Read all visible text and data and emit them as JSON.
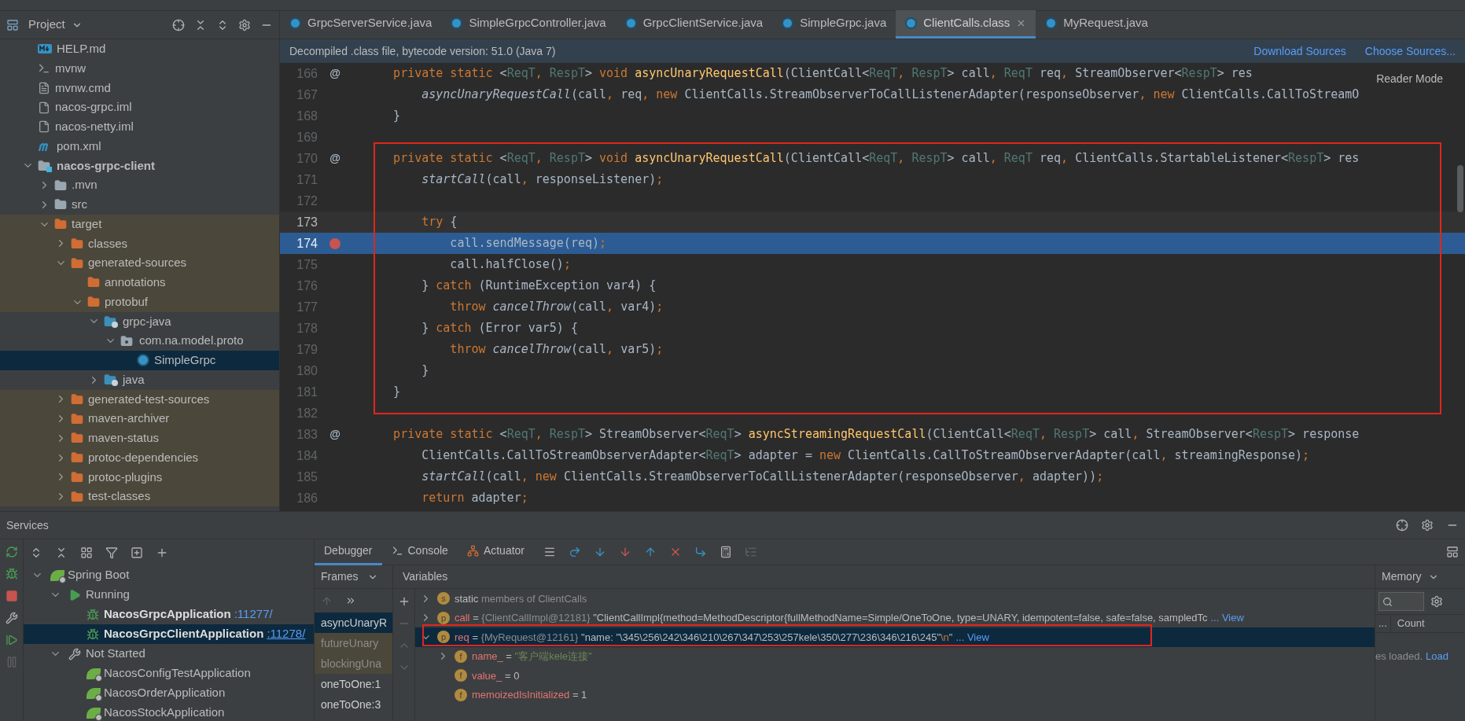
{
  "project_panel": {
    "title": "Project"
  },
  "project_tree": [
    {
      "label": "HELP.md",
      "kind": "md",
      "selected": false,
      "excluded": false
    },
    {
      "label": "mvnw",
      "kind": "script",
      "selected": false,
      "excluded": false
    },
    {
      "label": "mvnw.cmd",
      "kind": "text",
      "selected": false,
      "excluded": false
    },
    {
      "label": "nacos-grpc.iml",
      "kind": "iml",
      "selected": false,
      "excluded": false
    },
    {
      "label": "nacos-netty.iml",
      "kind": "iml",
      "selected": false,
      "excluded": false
    },
    {
      "label": "pom.xml",
      "kind": "maven",
      "selected": false,
      "excluded": false
    },
    {
      "label": "nacos-grpc-client",
      "kind": "module",
      "selected": false,
      "excluded": false,
      "expanded": true,
      "children": [
        {
          "label": ".mvn",
          "kind": "folder",
          "selected": false,
          "excluded": false,
          "expanded": false
        },
        {
          "label": "src",
          "kind": "folder",
          "selected": false,
          "excluded": false,
          "expanded": false
        },
        {
          "label": "target",
          "kind": "folder",
          "selected": false,
          "excluded": true,
          "expanded": true,
          "children": [
            {
              "label": "classes",
              "kind": "folder",
              "selected": false,
              "excluded": true,
              "expanded": false
            },
            {
              "label": "generated-sources",
              "kind": "folder",
              "selected": false,
              "excluded": true,
              "expanded": true,
              "children": [
                {
                  "label": "annotations",
                  "kind": "folder",
                  "selected": false,
                  "excluded": true
                },
                {
                  "label": "protobuf",
                  "kind": "folder",
                  "selected": false,
                  "excluded": true,
                  "expanded": true,
                  "children": [
                    {
                      "label": "grpc-java",
                      "kind": "source",
                      "selected": false,
                      "excluded": false,
                      "expanded": true,
                      "children": [
                        {
                          "label": "com.na.model.proto",
                          "kind": "package",
                          "selected": false,
                          "excluded": false,
                          "expanded": true,
                          "children": [
                            {
                              "label": "SimpleGrpc",
                              "kind": "class",
                              "selected": true
                            }
                          ]
                        }
                      ]
                    },
                    {
                      "label": "java",
                      "kind": "source",
                      "selected": false,
                      "excluded": false,
                      "expanded": false
                    }
                  ]
                }
              ]
            },
            {
              "label": "generated-test-sources",
              "kind": "folder",
              "selected": false,
              "excluded": true,
              "expanded": false
            },
            {
              "label": "maven-archiver",
              "kind": "folder",
              "selected": false,
              "excluded": true,
              "expanded": false
            },
            {
              "label": "maven-status",
              "kind": "folder",
              "selected": false,
              "excluded": true,
              "expanded": false
            },
            {
              "label": "protoc-dependencies",
              "kind": "folder",
              "selected": false,
              "excluded": true,
              "expanded": false
            },
            {
              "label": "protoc-plugins",
              "kind": "folder",
              "selected": false,
              "excluded": true,
              "expanded": false
            },
            {
              "label": "test-classes",
              "kind": "folder",
              "selected": false,
              "excluded": true,
              "expanded": false
            }
          ]
        }
      ]
    }
  ],
  "tabs": [
    {
      "label": "GrpcServerService.java",
      "selected": false
    },
    {
      "label": "SimpleGrpcController.java",
      "selected": false
    },
    {
      "label": "GrpcClientService.java",
      "selected": false
    },
    {
      "label": "SimpleGrpc.java",
      "selected": false
    },
    {
      "label": "ClientCalls.class",
      "selected": true
    },
    {
      "label": "MyRequest.java",
      "selected": false
    }
  ],
  "notice": {
    "text": "Decompiled .class file, bytecode version: 51.0 (Java 7)",
    "actions": [
      "Download Sources",
      "Choose Sources..."
    ]
  },
  "reader_mode": "Reader Mode",
  "code_lines": [
    {
      "number": "166",
      "annotation": "@",
      "selected": false,
      "caret": false,
      "tokens": [
        {
          "kind": "kw",
          "text": "    private static "
        },
        {
          "kind": "p",
          "text": "<"
        },
        {
          "kind": "gen",
          "text": "ReqT"
        },
        {
          "kind": "punc",
          "text": ", "
        },
        {
          "kind": "gen",
          "text": "RespT"
        },
        {
          "kind": "p",
          "text": "> "
        },
        {
          "kind": "kw",
          "text": "void "
        },
        {
          "kind": "decl",
          "text": "asyncUnaryRequestCall"
        },
        {
          "kind": "p",
          "text": "(ClientCall<"
        },
        {
          "kind": "gen",
          "text": "ReqT"
        },
        {
          "kind": "punc",
          "text": ", "
        },
        {
          "kind": "gen",
          "text": "RespT"
        },
        {
          "kind": "p",
          "text": "> call"
        },
        {
          "kind": "punc",
          "text": ", "
        },
        {
          "kind": "gen",
          "text": "ReqT "
        },
        {
          "kind": "p",
          "text": "req"
        },
        {
          "kind": "punc",
          "text": ", "
        },
        {
          "kind": "p",
          "text": "StreamObserver<"
        },
        {
          "kind": "gen",
          "text": "RespT"
        },
        {
          "kind": "p",
          "text": "> res"
        }
      ]
    },
    {
      "number": "167",
      "selected": false,
      "caret": false,
      "tokens": [
        {
          "kind": "it",
          "text": "        asyncUnaryRequestCall"
        },
        {
          "kind": "p",
          "text": "(call"
        },
        {
          "kind": "punc",
          "text": ", "
        },
        {
          "kind": "p",
          "text": "req"
        },
        {
          "kind": "punc",
          "text": ", "
        },
        {
          "kind": "kw",
          "text": "new "
        },
        {
          "kind": "p",
          "text": "ClientCalls.StreamObserverToCallListenerAdapter(responseObserver"
        },
        {
          "kind": "punc",
          "text": ", "
        },
        {
          "kind": "kw",
          "text": "new "
        },
        {
          "kind": "p",
          "text": "ClientCalls.CallToStreamO"
        }
      ]
    },
    {
      "number": "168",
      "selected": false,
      "caret": false,
      "tokens": [
        {
          "kind": "p",
          "text": "    }"
        }
      ]
    },
    {
      "number": "169",
      "selected": false,
      "caret": false
    },
    {
      "number": "170",
      "annotation": "@",
      "selected": false,
      "caret": false,
      "tokens": [
        {
          "kind": "kw",
          "text": "    private static "
        },
        {
          "kind": "p",
          "text": "<"
        },
        {
          "kind": "gen",
          "text": "ReqT"
        },
        {
          "kind": "punc",
          "text": ", "
        },
        {
          "kind": "gen",
          "text": "RespT"
        },
        {
          "kind": "p",
          "text": "> "
        },
        {
          "kind": "kw",
          "text": "void "
        },
        {
          "kind": "decl",
          "text": "asyncUnaryRequestCall"
        },
        {
          "kind": "p",
          "text": "(ClientCall<"
        },
        {
          "kind": "gen",
          "text": "ReqT"
        },
        {
          "kind": "punc",
          "text": ", "
        },
        {
          "kind": "gen",
          "text": "RespT"
        },
        {
          "kind": "p",
          "text": "> call"
        },
        {
          "kind": "punc",
          "text": ", "
        },
        {
          "kind": "gen",
          "text": "ReqT "
        },
        {
          "kind": "p",
          "text": "req"
        },
        {
          "kind": "punc",
          "text": ", "
        },
        {
          "kind": "p",
          "text": "ClientCalls.StartableListener<"
        },
        {
          "kind": "gen",
          "text": "RespT"
        },
        {
          "kind": "p",
          "text": "> res"
        }
      ]
    },
    {
      "number": "171",
      "selected": false,
      "caret": false,
      "tokens": [
        {
          "kind": "it",
          "text": "        startCall"
        },
        {
          "kind": "p",
          "text": "(call"
        },
        {
          "kind": "punc",
          "text": ", "
        },
        {
          "kind": "p",
          "text": "responseListener)"
        },
        {
          "kind": "punc",
          "text": ";"
        }
      ]
    },
    {
      "number": "172",
      "selected": false,
      "caret": false
    },
    {
      "number": "173",
      "selected": false,
      "caret": true,
      "tokens": [
        {
          "kind": "kw",
          "text": "        try "
        },
        {
          "kind": "p",
          "text": "{"
        }
      ]
    },
    {
      "number": "174",
      "breakpoint": true,
      "selected": true,
      "caret": false,
      "tokens": [
        {
          "kind": "p",
          "text": "            call.sendMessage(req)"
        },
        {
          "kind": "punc",
          "text": ";"
        }
      ]
    },
    {
      "number": "175",
      "selected": false,
      "caret": false,
      "tokens": [
        {
          "kind": "p",
          "text": "            call.halfClose()"
        },
        {
          "kind": "punc",
          "text": ";"
        }
      ]
    },
    {
      "number": "176",
      "selected": false,
      "caret": false,
      "tokens": [
        {
          "kind": "p",
          "text": "        } "
        },
        {
          "kind": "kw",
          "text": "catch "
        },
        {
          "kind": "p",
          "text": "(RuntimeException var4) {"
        }
      ]
    },
    {
      "number": "177",
      "selected": false,
      "caret": false,
      "tokens": [
        {
          "kind": "kw",
          "text": "            throw "
        },
        {
          "kind": "it",
          "text": "cancelThrow"
        },
        {
          "kind": "p",
          "text": "(call"
        },
        {
          "kind": "punc",
          "text": ", "
        },
        {
          "kind": "p",
          "text": "var4)"
        },
        {
          "kind": "punc",
          "text": ";"
        }
      ]
    },
    {
      "number": "178",
      "selected": false,
      "caret": false,
      "tokens": [
        {
          "kind": "p",
          "text": "        } "
        },
        {
          "kind": "kw",
          "text": "catch "
        },
        {
          "kind": "p",
          "text": "(Error var5) {"
        }
      ]
    },
    {
      "number": "179",
      "selected": false,
      "caret": false,
      "tokens": [
        {
          "kind": "kw",
          "text": "            throw "
        },
        {
          "kind": "it",
          "text": "cancelThrow"
        },
        {
          "kind": "p",
          "text": "(call"
        },
        {
          "kind": "punc",
          "text": ", "
        },
        {
          "kind": "p",
          "text": "var5)"
        },
        {
          "kind": "punc",
          "text": ";"
        }
      ]
    },
    {
      "number": "180",
      "selected": false,
      "caret": false,
      "tokens": [
        {
          "kind": "p",
          "text": "        }"
        }
      ]
    },
    {
      "number": "181",
      "selected": false,
      "caret": false,
      "tokens": [
        {
          "kind": "p",
          "text": "    }"
        }
      ]
    },
    {
      "number": "182",
      "selected": false,
      "caret": false
    },
    {
      "number": "183",
      "annotation": "@",
      "selected": false,
      "caret": false,
      "tokens": [
        {
          "kind": "kw",
          "text": "    private static "
        },
        {
          "kind": "p",
          "text": "<"
        },
        {
          "kind": "gen",
          "text": "ReqT"
        },
        {
          "kind": "punc",
          "text": ", "
        },
        {
          "kind": "gen",
          "text": "RespT"
        },
        {
          "kind": "p",
          "text": "> StreamObserver<"
        },
        {
          "kind": "gen",
          "text": "ReqT"
        },
        {
          "kind": "p",
          "text": "> "
        },
        {
          "kind": "decl",
          "text": "asyncStreamingRequestCall"
        },
        {
          "kind": "p",
          "text": "(ClientCall<"
        },
        {
          "kind": "gen",
          "text": "ReqT"
        },
        {
          "kind": "punc",
          "text": ", "
        },
        {
          "kind": "gen",
          "text": "RespT"
        },
        {
          "kind": "p",
          "text": "> call"
        },
        {
          "kind": "punc",
          "text": ", "
        },
        {
          "kind": "p",
          "text": "StreamObserver<"
        },
        {
          "kind": "gen",
          "text": "RespT"
        },
        {
          "kind": "p",
          "text": "> response"
        }
      ]
    },
    {
      "number": "184",
      "selected": false,
      "caret": false,
      "tokens": [
        {
          "kind": "p",
          "text": "        ClientCalls.CallToStreamObserverAdapter<"
        },
        {
          "kind": "gen",
          "text": "ReqT"
        },
        {
          "kind": "p",
          "text": "> adapter = "
        },
        {
          "kind": "kw",
          "text": "new "
        },
        {
          "kind": "p",
          "text": "ClientCalls.CallToStreamObserverAdapter(call"
        },
        {
          "kind": "punc",
          "text": ", "
        },
        {
          "kind": "p",
          "text": "streamingResponse)"
        },
        {
          "kind": "punc",
          "text": ";"
        }
      ]
    },
    {
      "number": "185",
      "selected": false,
      "caret": false,
      "tokens": [
        {
          "kind": "it",
          "text": "        startCall"
        },
        {
          "kind": "p",
          "text": "(call"
        },
        {
          "kind": "punc",
          "text": ", "
        },
        {
          "kind": "kw",
          "text": "new "
        },
        {
          "kind": "p",
          "text": "ClientCalls.StreamObserverToCallListenerAdapter(responseObserver"
        },
        {
          "kind": "punc",
          "text": ", "
        },
        {
          "kind": "p",
          "text": "adapter))"
        },
        {
          "kind": "punc",
          "text": ";"
        }
      ]
    },
    {
      "number": "186",
      "selected": false,
      "caret": false,
      "tokens": [
        {
          "kind": "kw",
          "text": "        return "
        },
        {
          "kind": "p",
          "text": "adapter"
        },
        {
          "kind": "punc",
          "text": ";"
        }
      ]
    }
  ],
  "services": {
    "title": "Services",
    "tree": [
      {
        "label": "Spring Boot",
        "kind": "group",
        "expanded": true,
        "selected": false,
        "children": [
          {
            "label": "Running",
            "kind": "running",
            "expanded": true,
            "selected": false,
            "children": [
              {
                "label": "NacosGrpcApplication",
                "port": ":11277/",
                "kind": "app-debug",
                "selected": false
              },
              {
                "label": "NacosGrpcClientApplication",
                "port": ":11278/",
                "kind": "app-debug",
                "selected": true
              }
            ]
          },
          {
            "label": "Not Started",
            "kind": "stopped",
            "expanded": true,
            "selected": false,
            "children": [
              {
                "label": "NacosConfigTestApplication",
                "kind": "app",
                "selected": false
              },
              {
                "label": "NacosOrderApplication",
                "kind": "app",
                "selected": false
              },
              {
                "label": "NacosStockApplication",
                "kind": "app",
                "selected": false
              }
            ]
          }
        ]
      }
    ]
  },
  "debugger": {
    "tabs": [
      {
        "label": "Debugger",
        "kind": "debugger",
        "selected": true
      },
      {
        "label": "Console",
        "kind": "console",
        "selected": false
      },
      {
        "label": "Actuator",
        "kind": "actuator",
        "selected": false
      }
    ],
    "frames_title": "Frames",
    "frames": [
      {
        "label": "asyncUnaryR",
        "selected": true,
        "library": false
      },
      {
        "label": "futureUnary",
        "selected": false,
        "library": true
      },
      {
        "label": "blockingUna",
        "selected": false,
        "library": true
      },
      {
        "label": "oneToOne:1",
        "selected": false,
        "library": false
      },
      {
        "label": "oneToOne:3",
        "selected": false,
        "library": false
      }
    ],
    "variables_title": "Variables",
    "variables": [
      {
        "badge": "s",
        "name": "static",
        "detail": "members of ClientCalls",
        "expanded": false,
        "selected": false
      },
      {
        "badge": "p",
        "name": "call",
        "expanded": false,
        "selected": false,
        "parts": [
          {
            "kind": "op",
            "text": " = "
          },
          {
            "kind": "ref",
            "text": "{ClientCallImpl@12181} "
          },
          {
            "kind": "str",
            "text": "\"ClientCallImpl{method=MethodDescriptor{fullMethodName=Simple/OneToOne, type=UNARY, idempotent=false, safe=false, sampledTc"
          }
        ],
        "view": "... View"
      },
      {
        "badge": "p",
        "name": "req",
        "expanded": true,
        "selected": true,
        "parts": [
          {
            "kind": "op",
            "text": " = "
          },
          {
            "kind": "ref",
            "text": "{MyRequest@12161} "
          },
          {
            "kind": "str",
            "text": "\"name: \"\\345\\256\\242\\346\\210\\267\\347\\253\\257kele\\350\\277\\236\\346\\216\\245\""
          },
          {
            "kind": "esc",
            "text": "\\n"
          },
          {
            "kind": "str",
            "text": "\""
          }
        ],
        "view": "... View",
        "children": [
          {
            "badge": "f",
            "name": "name_",
            "expanded": false,
            "selected": false,
            "parts": [
              {
                "kind": "op",
                "text": " = "
              },
              {
                "kind": "strv",
                "text": "\"客户端kele连接\""
              }
            ]
          },
          {
            "badge": "f",
            "name": "value_",
            "selected": false,
            "parts": [
              {
                "kind": "op",
                "text": " = "
              },
              {
                "kind": "num",
                "text": "0"
              }
            ]
          },
          {
            "badge": "f",
            "name": "memoizedIsInitialized",
            "selected": false,
            "parts": [
              {
                "kind": "op",
                "text": " = "
              },
              {
                "kind": "num",
                "text": "1"
              }
            ]
          }
        ]
      }
    ],
    "memory": {
      "tab": "Memory",
      "more": "...",
      "column": "Count",
      "status": "es loaded.",
      "link": "Load"
    }
  }
}
